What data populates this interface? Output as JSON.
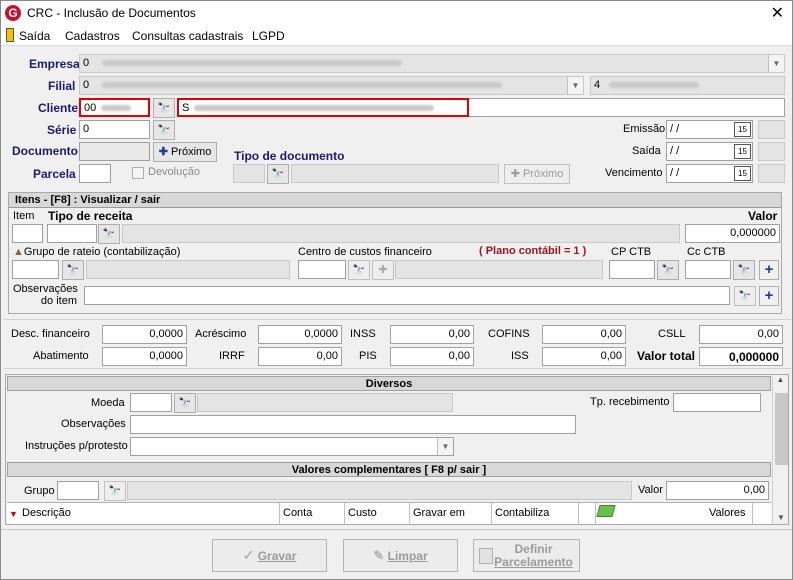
{
  "window": {
    "title": "CRC - Inclusão de Documentos",
    "logo_letter": "G",
    "close_glyph": "✕"
  },
  "menu": {
    "items": [
      "Saída",
      "Cadastros",
      "Consultas cadastrais",
      "LGPD"
    ]
  },
  "header": {
    "empresa_label": "Empresa",
    "empresa_value": "0",
    "filial_label": "Filial",
    "filial_value": "0",
    "filial_extra": "4",
    "cliente_label": "Cliente",
    "cliente_code": "00",
    "cliente_name": "S",
    "serie_label": "Série",
    "serie_value": "0",
    "documento_label": "Documento",
    "proximo_label": "Próximo",
    "parcela_label": "Parcela",
    "devolucao_label": "Devolução",
    "tipo_documento_label": "Tipo de documento",
    "proximo2_label": "Próximo",
    "emissao_label": "Emissão",
    "emissao_value": "/ /",
    "saida_label": "Saída",
    "saida_value": "/ /",
    "vencimento_label": "Vencimento",
    "vencimento_value": "/ /",
    "cal_glyph": "15"
  },
  "itens": {
    "title": "Itens  - [F8] : Visualizar / sair",
    "item_label": "Item",
    "tipo_receita_label": "Tipo de receita",
    "valor_label": "Valor",
    "valor_value": "0,000000",
    "grupo_rateio_label": "Grupo de rateio (contabilização)",
    "centro_custos_label": "Centro de custos financeiro",
    "plano_contabil": "( Plano contábil = 1 )",
    "cp_ctb_label": "CP CTB",
    "cc_ctb_label": "Cc CTB",
    "observacoes_label_1": "Observações",
    "observacoes_label_2": "do item"
  },
  "totais": {
    "desc_financeiro_label": "Desc. financeiro",
    "desc_financeiro": "0,0000",
    "acrescimo_label": "Acréscimo",
    "acrescimo": "0,0000",
    "inss_label": "INSS",
    "inss": "0,00",
    "cofins_label": "COFINS",
    "cofins": "0,00",
    "csll_label": "CSLL",
    "csll": "0,00",
    "abatimento_label": "Abatimento",
    "abatimento": "0,0000",
    "irrf_label": "IRRF",
    "irrf": "0,00",
    "pis_label": "PIS",
    "pis": "0,00",
    "iss_label": "ISS",
    "iss": "0,00",
    "valor_total_label": "Valor total",
    "valor_total": "0,000000"
  },
  "diversos": {
    "title": "Diversos",
    "moeda_label": "Moeda",
    "tp_recebimento_label": "Tp. recebimento",
    "observacoes_label": "Observações",
    "instrucoes_label": "Instruções p/protesto"
  },
  "complementares": {
    "title": "Valores complementares [ F8 p/ sair ]",
    "grupo_label": "Grupo",
    "valor_label": "Valor",
    "valor_value": "0,00",
    "columns": [
      "Descrição",
      "Conta",
      "Custo",
      "Gravar em",
      "Contabiliza",
      "",
      "Valores"
    ]
  },
  "footer": {
    "gravar_label": "Gravar",
    "limpar_label": "Limpar",
    "definir_label_1": "Definir",
    "definir_label_2": "Parcelamento"
  }
}
